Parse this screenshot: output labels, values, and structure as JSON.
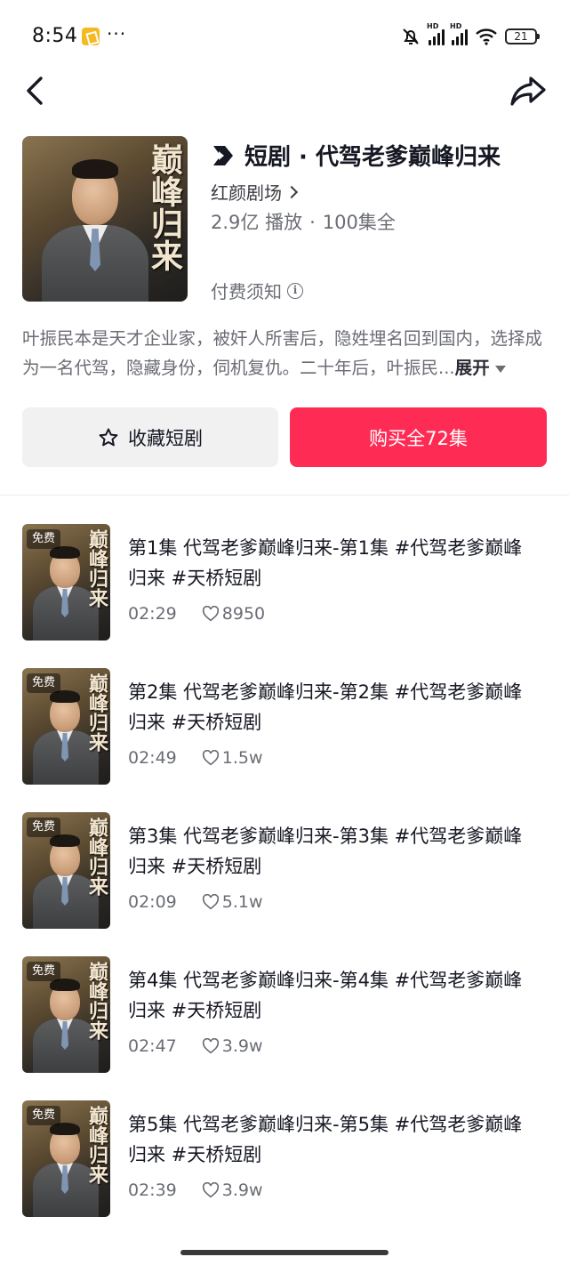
{
  "status_bar": {
    "time": "8:54",
    "dots": "···",
    "battery": "21",
    "hd_label": "HD"
  },
  "drama": {
    "icon": "play-drama-icon",
    "title": "短剧 · 代驾老爹巅峰归来",
    "studio": "红颜剧场",
    "plays": "2.9亿 播放",
    "episodes_total": "100集全",
    "separator": "·",
    "notice": "付费须知",
    "poster_title": "巅峰归来"
  },
  "description": {
    "text": "叶振民本是天才企业家，被奸人所害后，隐姓埋名回到国内，选择成为一名代驾，隐藏身份，伺机复仇。二十年后，叶振民...",
    "expand_label": "展开"
  },
  "actions": {
    "favorite_label": "收藏短剧",
    "buy_label": "购买全72集",
    "accent_color": "#fe2c55"
  },
  "episodes": [
    {
      "badge": "免费",
      "title": "第1集   代驾老爹巅峰归来-第1集 #代驾老爹巅峰归来 #天桥短剧",
      "duration": "02:29",
      "likes": "8950"
    },
    {
      "badge": "免费",
      "title": "第2集   代驾老爹巅峰归来-第2集 #代驾老爹巅峰归来 #天桥短剧",
      "duration": "02:49",
      "likes": "1.5w"
    },
    {
      "badge": "免费",
      "title": "第3集   代驾老爹巅峰归来-第3集 #代驾老爹巅峰归来 #天桥短剧",
      "duration": "02:09",
      "likes": "5.1w"
    },
    {
      "badge": "免费",
      "title": "第4集   代驾老爹巅峰归来-第4集 #代驾老爹巅峰归来 #天桥短剧",
      "duration": "02:47",
      "likes": "3.9w"
    },
    {
      "badge": "免费",
      "title": "第5集   代驾老爹巅峰归来-第5集 #代驾老爹巅峰归来 #天桥短剧",
      "duration": "02:39",
      "likes": "3.9w"
    }
  ]
}
